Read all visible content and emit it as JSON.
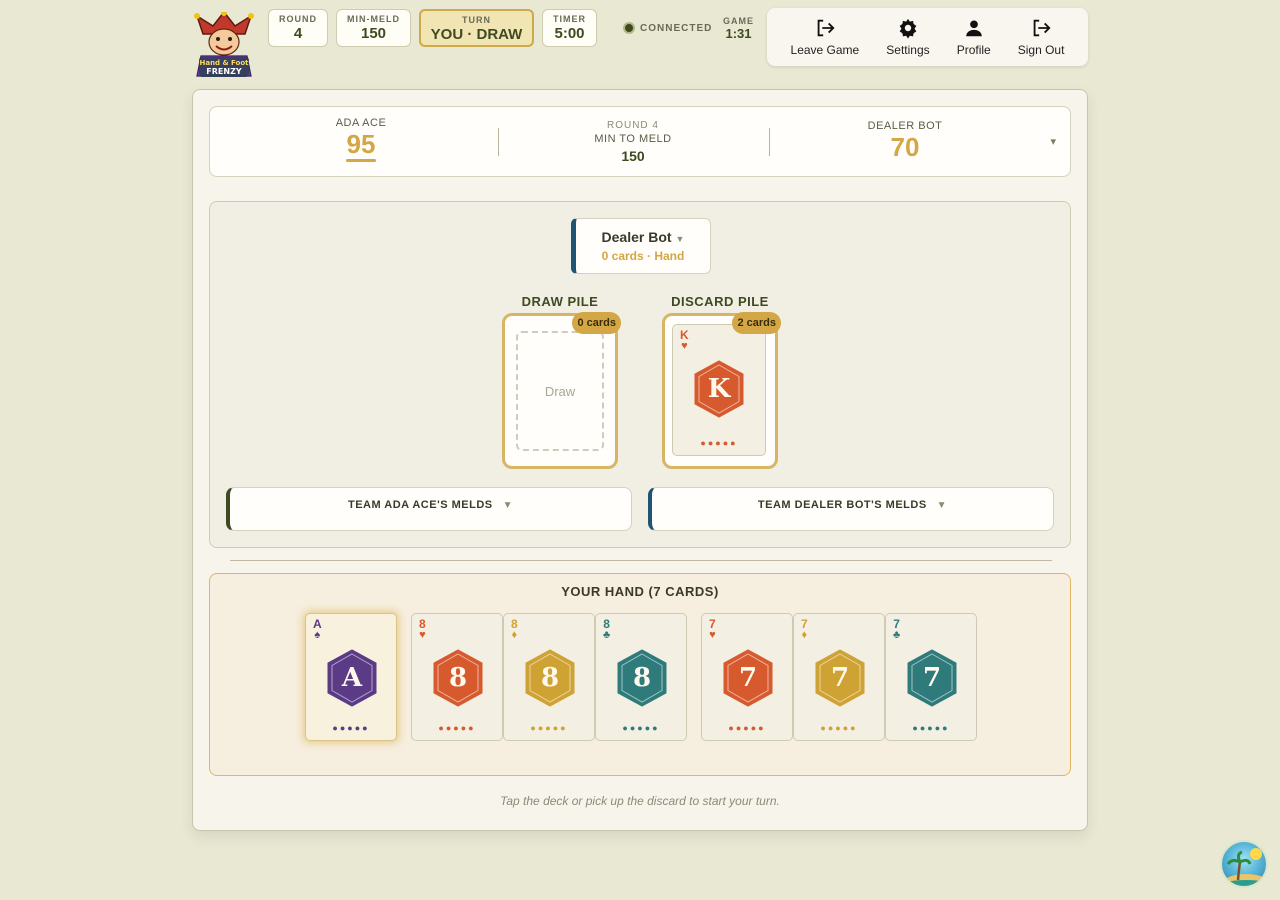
{
  "header": {
    "logo_text": "Hand & Foot FRENZY",
    "stats": [
      {
        "label": "ROUND",
        "value": "4"
      },
      {
        "label": "MIN-MELD",
        "value": "150"
      },
      {
        "label": "TURN",
        "value": "YOU · DRAW"
      },
      {
        "label": "TIMER",
        "value": "5:00"
      }
    ],
    "connection": "CONNECTED",
    "game_label": "GAME",
    "game_time": "1:31",
    "nav": [
      {
        "label": "Leave Game",
        "icon": "logout-icon"
      },
      {
        "label": "Settings",
        "icon": "gear-icon"
      },
      {
        "label": "Profile",
        "icon": "person-icon"
      },
      {
        "label": "Sign Out",
        "icon": "logout-icon"
      }
    ]
  },
  "scoreboard": {
    "left": {
      "name": "ADA ACE",
      "score": "95"
    },
    "middle": {
      "round": "ROUND 4",
      "label": "MIN TO MELD",
      "value": "150"
    },
    "right": {
      "name": "DEALER BOT",
      "score": "70"
    },
    "toggle": "▾"
  },
  "table": {
    "opponent": {
      "name": "Dealer Bot",
      "status": "0 cards · Hand"
    },
    "draw_pile": {
      "title": "DRAW PILE",
      "count": "0 cards",
      "slot_label": "Draw"
    },
    "discard_pile": {
      "title": "DISCARD PILE",
      "count": "2 cards",
      "top_card": {
        "rank": "K",
        "suit": "♥"
      }
    },
    "melds": [
      {
        "label": "TEAM ADA ACE'S MELDS"
      },
      {
        "label": "TEAM DEALER BOT'S MELDS"
      }
    ]
  },
  "hand": {
    "title": "YOUR HAND (7 CARDS)",
    "cards": [
      {
        "rank": "A",
        "suit": "♠"
      },
      {
        "rank": "8",
        "suit": "♥"
      },
      {
        "rank": "8",
        "suit": "♦"
      },
      {
        "rank": "8",
        "suit": "♣"
      },
      {
        "rank": "7",
        "suit": "♥"
      },
      {
        "rank": "7",
        "suit": "♦"
      },
      {
        "rank": "7",
        "suit": "♣"
      }
    ]
  },
  "hint": "Tap the deck or pick up the discard to start your turn.",
  "colors": {
    "spades": "#5b3a86",
    "hearts": "#d75a2e",
    "diamonds": "#cfa234",
    "clubs": "#2f7b7c",
    "accent": "#d3a745",
    "team_a": "#3f4a22",
    "team_b": "#1f5472"
  }
}
